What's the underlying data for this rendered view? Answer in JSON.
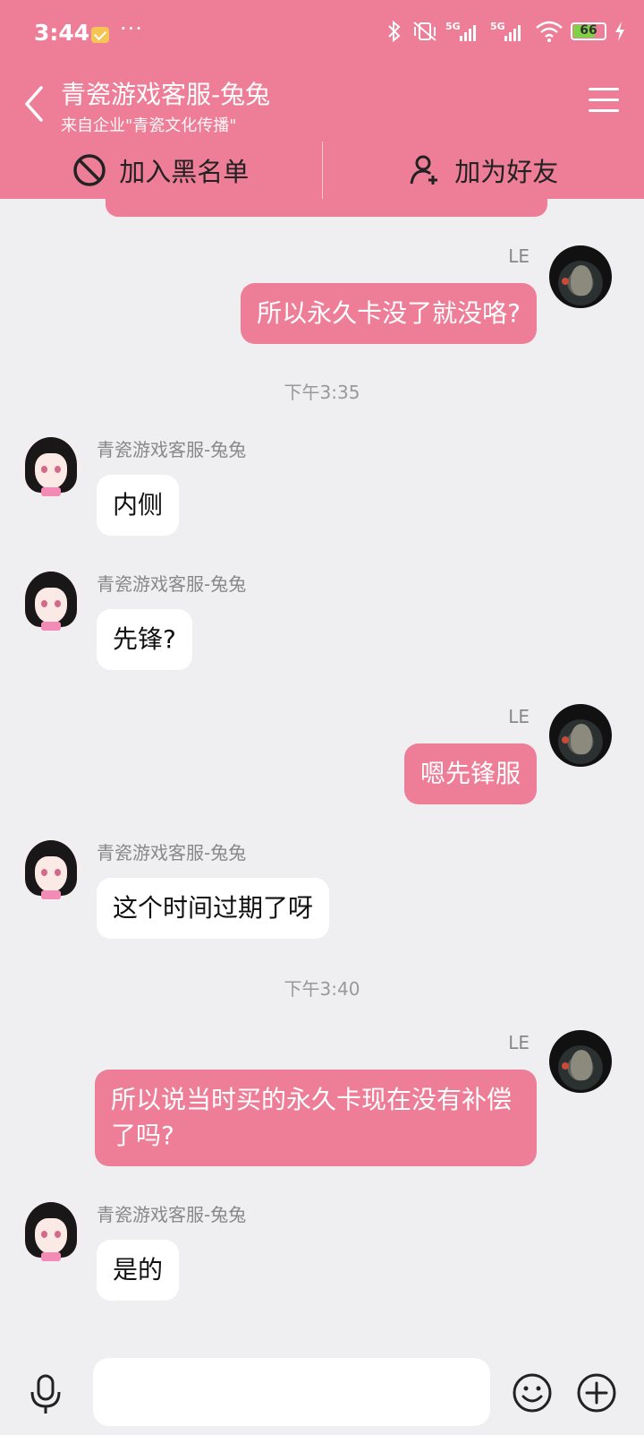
{
  "status_bar": {
    "time": "3:44",
    "more": "···",
    "battery": "66",
    "icons": [
      "mail-icon",
      "bluetooth-icon",
      "vibrate-off-icon",
      "signal-5g-icon",
      "signal-5g-icon",
      "wifi-icon",
      "battery-icon",
      "charging-icon"
    ]
  },
  "header": {
    "title": "青瓷游戏客服-兔兔",
    "subtitle": "来自企业\"青瓷文化传播\""
  },
  "actions": {
    "blacklist": "加入黑名单",
    "add_friend": "加为好友"
  },
  "messages": {
    "m1_name": "LE",
    "m1_text": "所以永久卡没了就没咯?",
    "t1": "下午3:35",
    "m2_name": "青瓷游戏客服-兔兔",
    "m2_text": "内侧",
    "m3_name": "青瓷游戏客服-兔兔",
    "m3_text": "先锋?",
    "m4_name": "LE",
    "m4_text": "嗯先锋服",
    "m5_name": "青瓷游戏客服-兔兔",
    "m5_text": "这个时间过期了呀",
    "t2": "下午3:40",
    "m6_name": "LE",
    "m6_text": "所以说当时买的永久卡现在没有补偿了吗?",
    "m7_name": "青瓷游戏客服-兔兔",
    "m7_text": "是的"
  },
  "colors": {
    "accent": "#ee7e98",
    "background": "#efeff2",
    "incoming_bubble": "#ffffff"
  }
}
